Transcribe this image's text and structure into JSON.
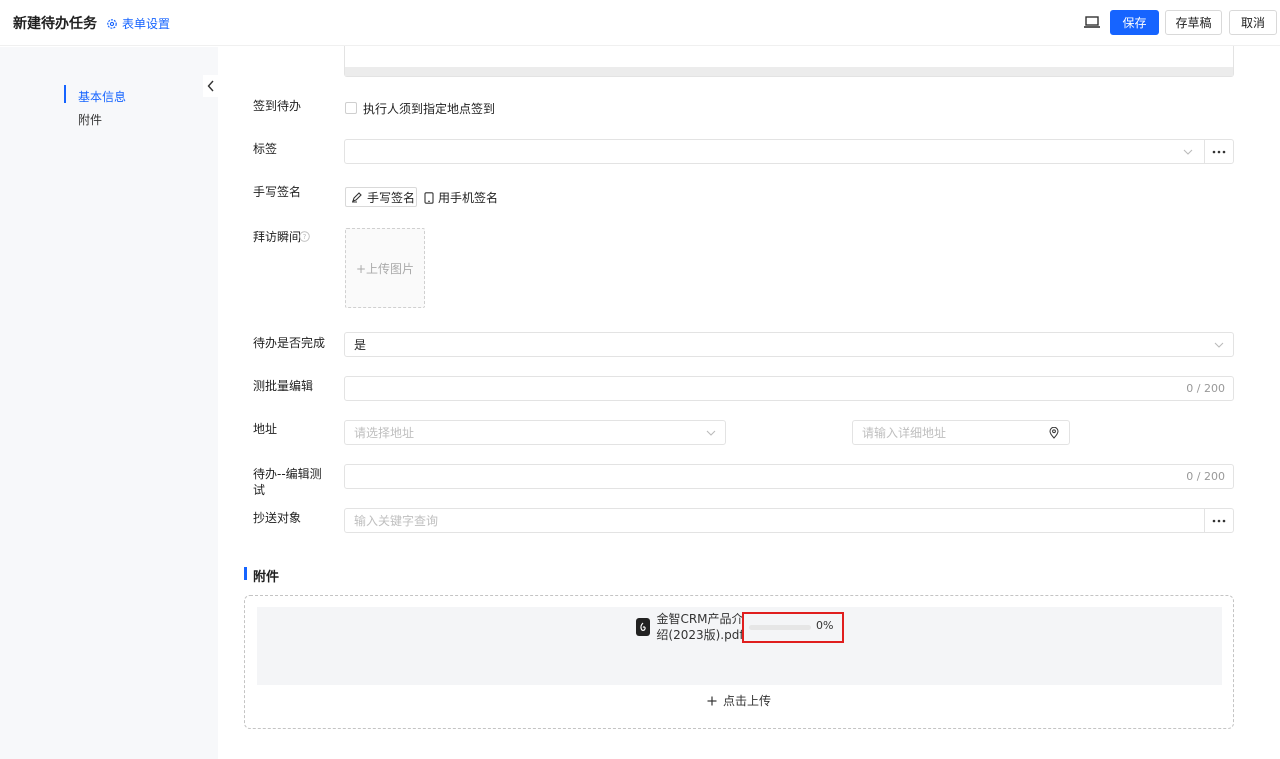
{
  "header": {
    "title": "新建待办任务",
    "form_settings": "表单设置",
    "save": "保存",
    "draft": "存草稿",
    "cancel": "取消"
  },
  "sidebar": {
    "items": [
      {
        "label": "基本信息",
        "active": true
      },
      {
        "label": "附件",
        "active": false
      }
    ]
  },
  "form": {
    "checkin": {
      "label": "签到待办",
      "option": "执行人须到指定地点签到",
      "checked": false
    },
    "tags": {
      "label": "标签",
      "value": ""
    },
    "signature": {
      "label": "手写签名",
      "handwrite": "手写签名",
      "phone": "用手机签名"
    },
    "visit": {
      "label": "拜访瞬间",
      "upload": "+上传图片"
    },
    "done": {
      "label": "待办是否完成",
      "value": "是"
    },
    "batch_edit": {
      "label": "测批量编辑",
      "counter": "0 / 200"
    },
    "address": {
      "label": "地址",
      "select_placeholder": "请选择地址",
      "detail_placeholder": "请输入详细地址"
    },
    "todo_edit": {
      "label": "待办--编辑测试",
      "counter": "0 / 200"
    },
    "cc": {
      "label": "抄送对象",
      "placeholder": "输入关键字查询"
    }
  },
  "attachments": {
    "title": "附件",
    "file": {
      "name": "金智CRM产品介绍(2023版).pdf",
      "progress_text": "0%",
      "progress": 0
    },
    "upload": "点击上传"
  },
  "colors": {
    "accent": "#1664ff",
    "highlight": "#e01e1e"
  }
}
